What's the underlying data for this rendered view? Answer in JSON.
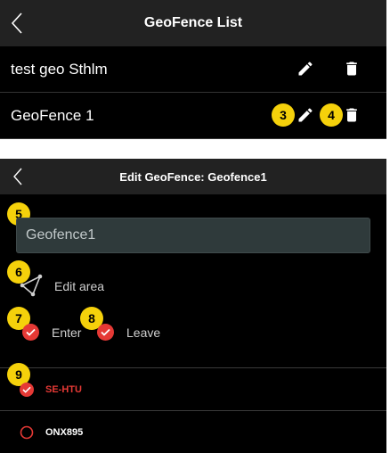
{
  "list_screen": {
    "title": "GeoFence List",
    "items": [
      {
        "name": "test geo Sthlm"
      },
      {
        "name": "GeoFence 1"
      }
    ],
    "badges": [
      "3",
      "4"
    ]
  },
  "edit_screen": {
    "title": "Edit GeoFence: Geofence1",
    "name_value": "Geofence1",
    "edit_area_label": "Edit area",
    "enter_label": "Enter",
    "leave_label": "Leave",
    "vehicles": [
      {
        "name": "SE-HTU",
        "selected": true
      },
      {
        "name": "ONX895",
        "selected": false
      }
    ],
    "badges": [
      "5",
      "6",
      "7",
      "8",
      "9"
    ]
  },
  "colors": {
    "accent_red": "#e53935",
    "badge_yellow": "#f5d10b",
    "header_bg": "#222222"
  },
  "icons": [
    "back-chevron-icon",
    "pencil-icon",
    "trash-icon",
    "polygon-icon",
    "check-icon",
    "radio-icon"
  ]
}
